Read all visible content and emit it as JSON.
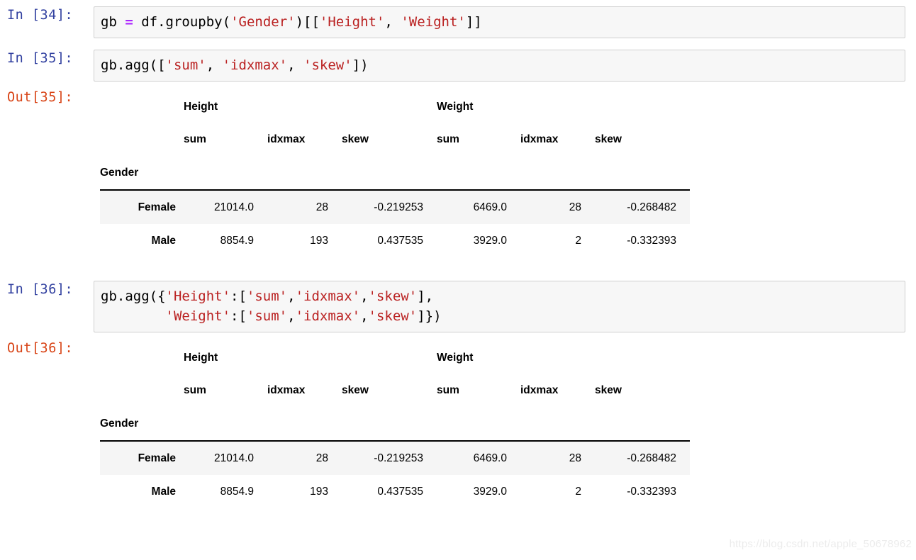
{
  "cells": [
    {
      "kind": "input",
      "prompt": "In [34]:",
      "lines": [
        [
          {
            "t": "gb ",
            "c": "plain"
          },
          {
            "t": "=",
            "c": "op"
          },
          {
            "t": " df.groupby(",
            "c": "plain"
          },
          {
            "t": "'Gender'",
            "c": "str"
          },
          {
            "t": ")[[",
            "c": "plain"
          },
          {
            "t": "'Height'",
            "c": "str"
          },
          {
            "t": ", ",
            "c": "plain"
          },
          {
            "t": "'Weight'",
            "c": "str"
          },
          {
            "t": "]]",
            "c": "plain"
          }
        ]
      ]
    },
    {
      "kind": "input",
      "prompt": "In [35]:",
      "lines": [
        [
          {
            "t": "gb.agg([",
            "c": "plain"
          },
          {
            "t": "'sum'",
            "c": "str"
          },
          {
            "t": ", ",
            "c": "plain"
          },
          {
            "t": "'idxmax'",
            "c": "str"
          },
          {
            "t": ", ",
            "c": "plain"
          },
          {
            "t": "'skew'",
            "c": "str"
          },
          {
            "t": "])",
            "c": "plain"
          }
        ]
      ]
    },
    {
      "kind": "output",
      "prompt": "Out[35]:",
      "table_ref": 0
    },
    {
      "kind": "input",
      "prompt": "In [36]:",
      "lines": [
        [
          {
            "t": "gb.agg({",
            "c": "plain"
          },
          {
            "t": "'Height'",
            "c": "str"
          },
          {
            "t": ":[",
            "c": "plain"
          },
          {
            "t": "'sum'",
            "c": "str"
          },
          {
            "t": ",",
            "c": "plain"
          },
          {
            "t": "'idxmax'",
            "c": "str"
          },
          {
            "t": ",",
            "c": "plain"
          },
          {
            "t": "'skew'",
            "c": "str"
          },
          {
            "t": "],",
            "c": "plain"
          }
        ],
        [
          {
            "t": "        ",
            "c": "plain"
          },
          {
            "t": "'Weight'",
            "c": "str"
          },
          {
            "t": ":[",
            "c": "plain"
          },
          {
            "t": "'sum'",
            "c": "str"
          },
          {
            "t": ",",
            "c": "plain"
          },
          {
            "t": "'idxmax'",
            "c": "str"
          },
          {
            "t": ",",
            "c": "plain"
          },
          {
            "t": "'skew'",
            "c": "str"
          },
          {
            "t": "]})",
            "c": "plain"
          }
        ]
      ]
    },
    {
      "kind": "output",
      "prompt": "Out[36]:",
      "table_ref": 1
    }
  ],
  "tables": [
    {
      "index_name": "Gender",
      "group_headers": [
        "Height",
        "Weight"
      ],
      "sub_headers": [
        "sum",
        "idxmax",
        "skew"
      ],
      "rows": [
        {
          "index": "Female",
          "values": [
            "21014.0",
            "28",
            "-0.219253",
            "6469.0",
            "28",
            "-0.268482"
          ],
          "striped": true
        },
        {
          "index": "Male",
          "values": [
            "8854.9",
            "193",
            "0.437535",
            "3929.0",
            "2",
            "-0.332393"
          ],
          "striped": false
        }
      ]
    },
    {
      "index_name": "Gender",
      "group_headers": [
        "Height",
        "Weight"
      ],
      "sub_headers": [
        "sum",
        "idxmax",
        "skew"
      ],
      "rows": [
        {
          "index": "Female",
          "values": [
            "21014.0",
            "28",
            "-0.219253",
            "6469.0",
            "28",
            "-0.268482"
          ],
          "striped": true
        },
        {
          "index": "Male",
          "values": [
            "8854.9",
            "193",
            "0.437535",
            "3929.0",
            "2",
            "-0.332393"
          ],
          "striped": false
        }
      ]
    }
  ],
  "watermark": {
    "text": "https://blog.csdn.net/apple_50678962"
  },
  "colors": {
    "prompt_in": "#303F9F",
    "prompt_out": "#D84315",
    "string_literal": "#BA2121",
    "operator": "#AA22FF",
    "cell_background": "#f7f7f7",
    "cell_border": "#cfcfcf",
    "row_stripe": "#f5f5f5",
    "page_background": "#ffffff"
  }
}
